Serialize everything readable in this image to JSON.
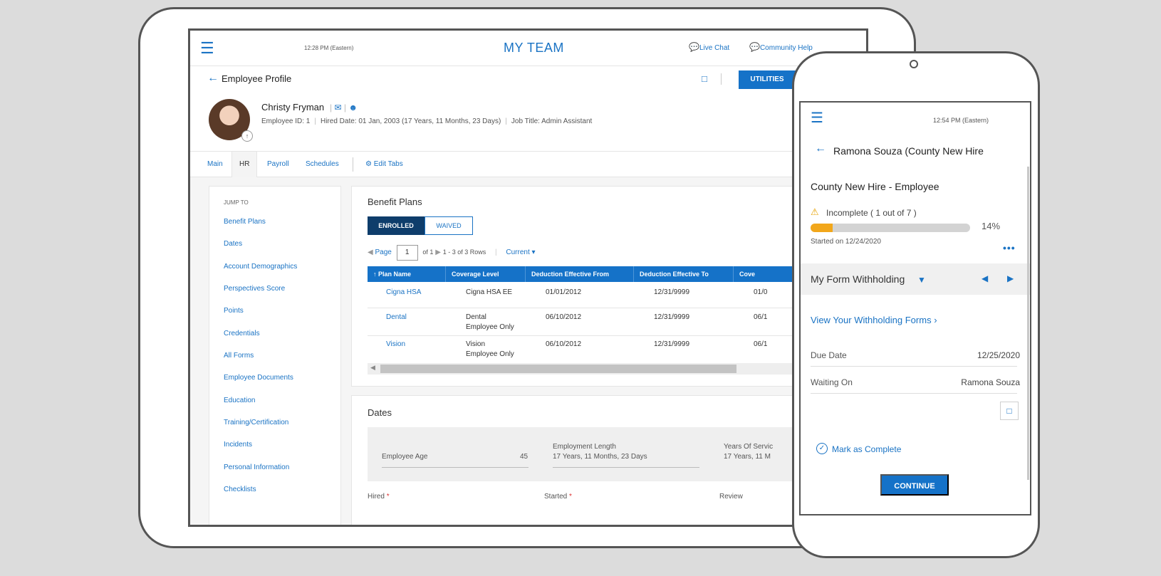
{
  "tablet": {
    "topbar": {
      "time": "12:28 PM (Eastern)",
      "app_title": "MY TEAM",
      "live_chat": "Live Chat",
      "community_help": "Community Help"
    },
    "profile": {
      "page_title": "Employee Profile",
      "utilities": "UTILITIES",
      "name": "Christy Fryman",
      "employee_id": "Employee ID: 1",
      "hired_date": "Hired Date: 01 Jan, 2003 (17 Years, 11 Months, 23 Days)",
      "job_title": "Job Title: Admin Assistant"
    },
    "tabs": [
      "Main",
      "HR",
      "Payroll",
      "Schedules"
    ],
    "edit_tabs": "Edit Tabs",
    "jump_to": {
      "title": "JUMP TO",
      "items": [
        "Benefit Plans",
        "Dates",
        "Account Demographics",
        "Perspectives Score",
        "Points",
        "Credentials",
        "All Forms",
        "Employee Documents",
        "Education",
        "Training/Certification",
        "Incidents",
        "Personal Information",
        "Checklists"
      ]
    },
    "benefits": {
      "title": "Benefit Plans",
      "enrolled": "ENROLLED",
      "waived": "WAIVED",
      "pager_page": "Page",
      "pager_value": "1",
      "pager_of": "of 1",
      "pager_rows": "1 - 3 of 3 Rows",
      "current": "Current",
      "headers": [
        "Plan Name",
        "Coverage Level",
        "Deduction Effective From",
        "Deduction Effective To",
        "Cove"
      ],
      "rows": [
        {
          "plan": "Cigna HSA",
          "coverage": "Cigna HSA EE",
          "coverage2": "",
          "from": "01/01/2012",
          "to": "12/31/9999",
          "cov": "01/0"
        },
        {
          "plan": "Dental",
          "coverage": "Dental",
          "coverage2": "Employee Only",
          "from": "06/10/2012",
          "to": "12/31/9999",
          "cov": "06/1"
        },
        {
          "plan": "Vision",
          "coverage": "Vision",
          "coverage2": "Employee Only",
          "from": "06/10/2012",
          "to": "12/31/9999",
          "cov": "06/1"
        }
      ]
    },
    "dates": {
      "title": "Dates",
      "employee_age_label": "Employee Age",
      "employee_age_value": "45",
      "employment_length_label": "Employment Length",
      "employment_length_value": "17 Years, 11 Months, 23 Days",
      "years_service_label": "Years Of Servic",
      "years_service_value": "17 Years, 11 M",
      "hired": "Hired",
      "started": "Started",
      "review": "Review",
      "required_mark": "*"
    }
  },
  "phone": {
    "time": "12:54 PM (Eastern)",
    "title": "Ramona Souza (County New Hire",
    "heading": "County New Hire - Employee",
    "status": "Incomplete ( 1 out of 7 )",
    "progress_percent": 14,
    "progress_label": "14%",
    "started": "Started on 12/24/2020",
    "form_name": "My Form Withholding",
    "view_link": "View Your Withholding Forms",
    "due_date_label": "Due Date",
    "due_date_value": "12/25/2020",
    "waiting_on_label": "Waiting On",
    "waiting_on_value": "Ramona Souza",
    "mark_complete": "Mark as Complete",
    "continue": "CONTINUE"
  },
  "colors": {
    "primary": "#1572c8",
    "dark": "#0e3d6b",
    "warning": "#f2a71b"
  }
}
